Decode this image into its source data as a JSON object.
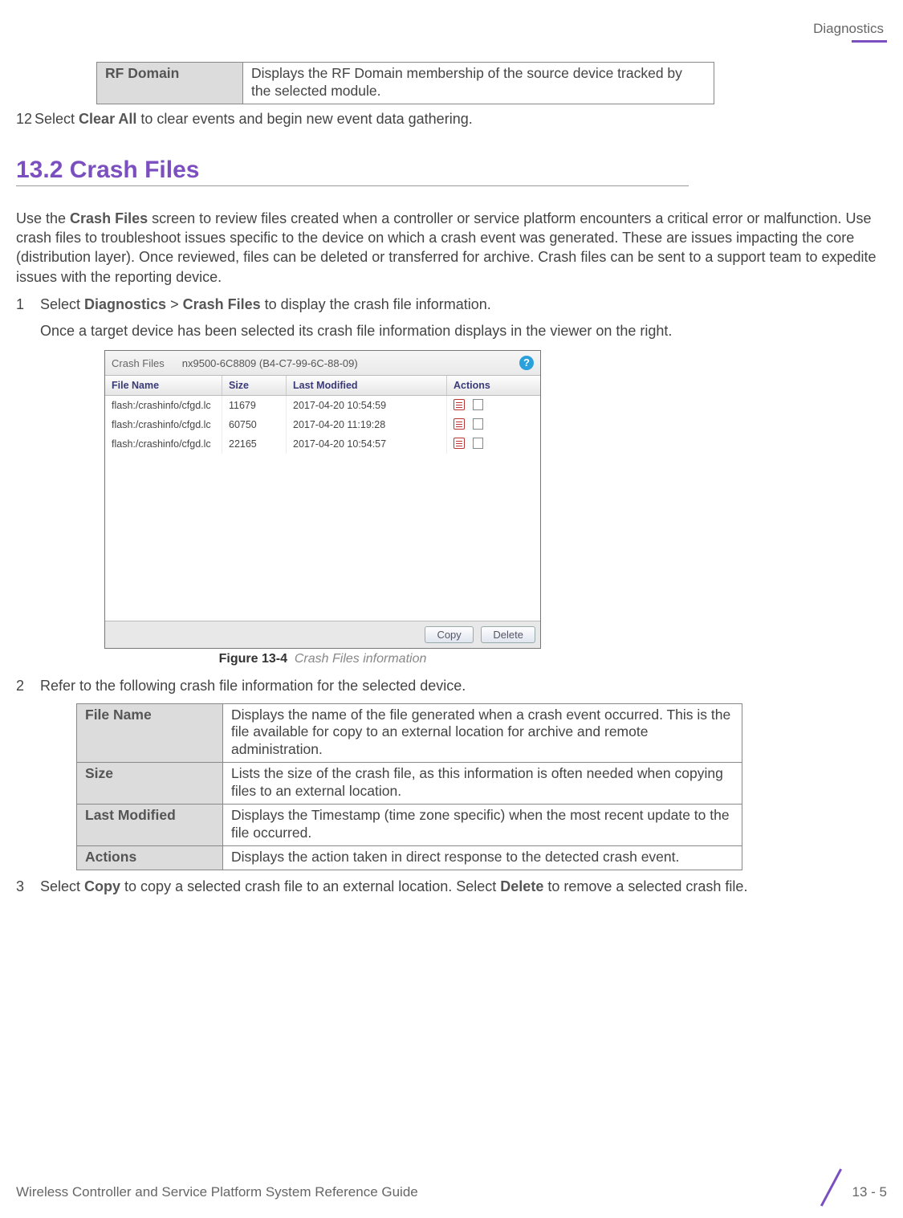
{
  "header": {
    "section": "Diagnostics"
  },
  "table1": {
    "label": "RF Domain",
    "desc": "Displays the RF Domain membership of the source device tracked by the selected module."
  },
  "line12": {
    "num": "12",
    "pre": "Select ",
    "bold": "Clear All",
    "post": " to clear events and begin new event data gathering."
  },
  "section": {
    "title": "13.2 Crash Files"
  },
  "intro": {
    "pre": "Use the ",
    "bold": "Crash Files",
    "post": " screen to review files created when a controller or service platform encounters a critical error or malfunction. Use crash files to troubleshoot issues specific to the device on which a crash event was generated. These are issues impacting the core (distribution layer). Once reviewed, files can be deleted or transferred for archive. Crash files can be sent to a support team to expedite issues with the reporting device."
  },
  "step1": {
    "num": "1",
    "pre": "Select ",
    "b1": "Diagnostics",
    "mid": " > ",
    "b2": "Crash Files",
    "post": " to display the crash file information."
  },
  "step1b": "Once a target device has been selected its crash file information displays in the viewer on the right.",
  "screenshot": {
    "title_label": "Crash Files",
    "device": "nx9500-6C8809 (B4-C7-99-6C-88-09)",
    "help": "?",
    "cols": {
      "a": "File Name",
      "b": "Size",
      "c": "Last Modified",
      "d": "Actions"
    },
    "rows": [
      {
        "a": "flash:/crashinfo/cfgd.lc",
        "b": "11679",
        "c": "2017-04-20 10:54:59"
      },
      {
        "a": "flash:/crashinfo/cfgd.lc",
        "b": "60750",
        "c": "2017-04-20 11:19:28"
      },
      {
        "a": "flash:/crashinfo/cfgd.lc",
        "b": "22165",
        "c": "2017-04-20 10:54:57"
      }
    ],
    "btn_copy": "Copy",
    "btn_delete": "Delete"
  },
  "figure": {
    "num": "Figure 13-4",
    "txt": "Crash Files information"
  },
  "step2": {
    "num": "2",
    "txt": "Refer to the following crash file information for the selected device."
  },
  "table2": [
    {
      "label": "File Name",
      "desc": "Displays the name of the file generated when a crash event occurred. This is the file available for copy to an external location for archive and remote administration."
    },
    {
      "label": "Size",
      "desc": "Lists the size of the crash file, as this information is often needed when copying files to an external location."
    },
    {
      "label": "Last Modified",
      "desc": "Displays the Timestamp (time zone specific) when the most recent update to the file occurred."
    },
    {
      "label": "Actions",
      "desc": "Displays the action taken in direct response to the detected crash event."
    }
  ],
  "step3": {
    "num": "3",
    "pre": "Select ",
    "b1": "Copy",
    "mid": " to copy a selected crash file to an external location. Select ",
    "b2": "Delete",
    "post": " to remove a selected crash file."
  },
  "footer": {
    "title": "Wireless Controller and Service Platform System Reference Guide",
    "page": "13 - 5"
  }
}
